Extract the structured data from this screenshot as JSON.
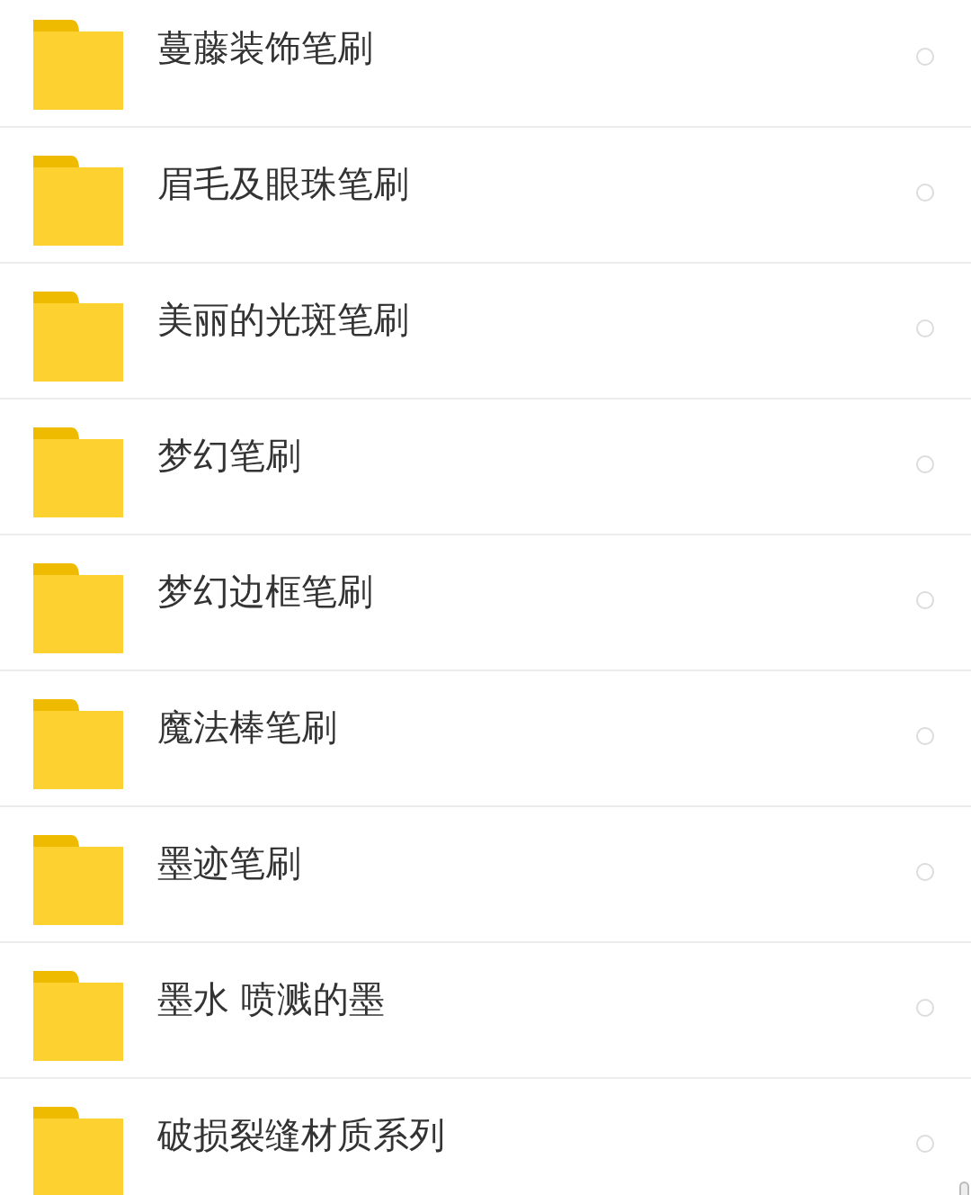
{
  "folders": [
    {
      "name": "蔓藤装饰笔刷",
      "selected": false
    },
    {
      "name": "眉毛及眼珠笔刷",
      "selected": false
    },
    {
      "name": "美丽的光斑笔刷",
      "selected": false
    },
    {
      "name": "梦幻笔刷",
      "selected": false
    },
    {
      "name": "梦幻边框笔刷",
      "selected": false
    },
    {
      "name": "魔法棒笔刷",
      "selected": false
    },
    {
      "name": "墨迹笔刷",
      "selected": false
    },
    {
      "name": "墨水 喷溅的墨",
      "selected": false
    },
    {
      "name": "破损裂缝材质系列",
      "selected": false
    }
  ]
}
